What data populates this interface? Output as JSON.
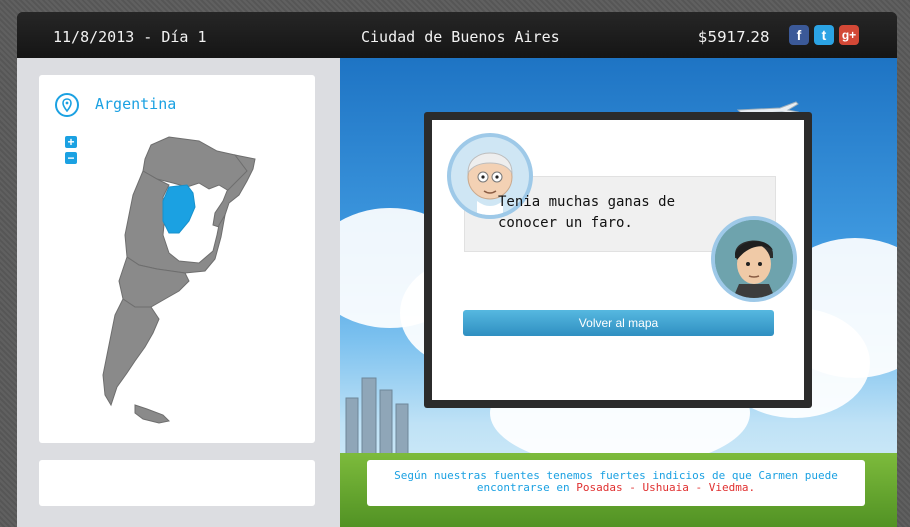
{
  "header": {
    "date": "11/8/2013 - Día 1",
    "city": "Ciudad de Buenos Aires",
    "money": "$5917.28",
    "social": [
      {
        "name": "facebook",
        "glyph": "f",
        "color": "#3b5998"
      },
      {
        "name": "twitter",
        "glyph": "t",
        "color": "#2ba3e4"
      },
      {
        "name": "google-plus",
        "glyph": "g+",
        "color": "#d34836"
      }
    ]
  },
  "map": {
    "country": "Argentina",
    "zoom_in": "+",
    "zoom_out": "−",
    "accent": "#1ba1e2",
    "land_color": "#8a8a8a",
    "highlight_color": "#1ba1e2"
  },
  "dialog": {
    "speech": "Tenia muchas ganas de conocer un faro.",
    "back_button": "Volver al mapa"
  },
  "clue": {
    "prefix": "Según nuestras fuentes tenemos fuertes indicios de que Carmen puede encontrarse en",
    "places": "Posadas - Ushuaia - Viedma",
    "suffix": "."
  }
}
